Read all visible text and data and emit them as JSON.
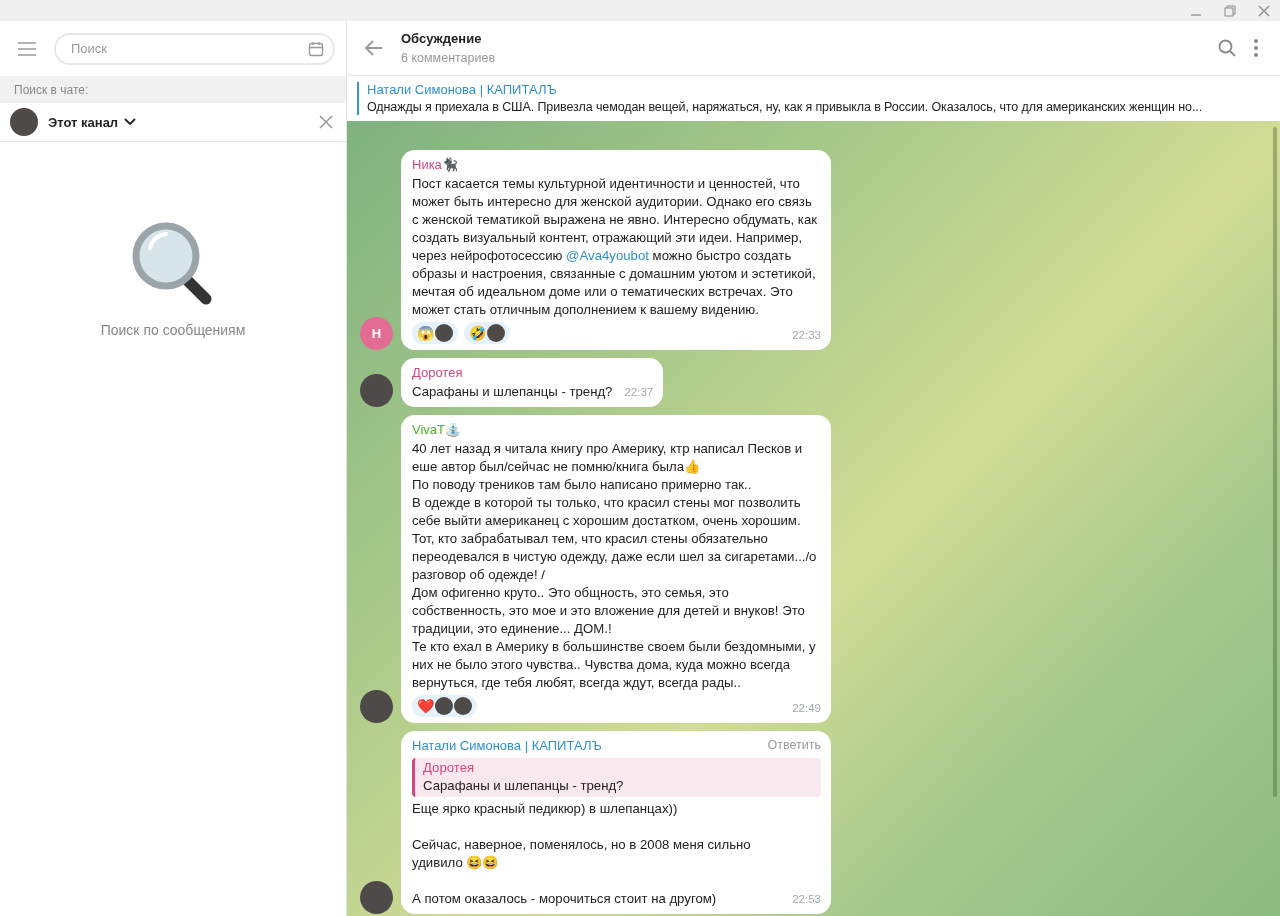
{
  "sidebar": {
    "search": {
      "placeholder": "Поиск"
    },
    "search_in_chat_label": "Поиск в чате:",
    "scope": {
      "label": "Этот канал"
    },
    "empty_state": {
      "text": "Поиск по сообщениям"
    }
  },
  "chat": {
    "title": "Обсуждение",
    "subtitle": "6 комментариев",
    "pinned": {
      "author": "Натали Симонова | КАПИТАЛЪ",
      "text": "Однажды я приехала в США. Привезла чемодан вещей, наряжаться, ну, как я привыкла в России. Оказалось, что для американских женщин но..."
    },
    "messages": [
      {
        "author": "Ника🐈‍⬛",
        "color": "#d6457f",
        "avatar": {
          "kind": "letter",
          "letter": "Н"
        },
        "text": [
          {
            "kind": "text",
            "text": "Пост касается темы культурной идентичности и ценностей, что может быть интересно для женской аудитории. Однако его связь с женской тематикой выражена не явно. Интересно обдумать, как создать визуальный контент, отражающий эти идеи. Например, через нейрофотосессию "
          },
          {
            "kind": "mention",
            "text": "@Ava4youbot"
          },
          {
            "kind": "text",
            "text": " можно быстро создать образы и настроения, связанные с домашним уютом и эстетикой, мечтая об идеальном доме или о тематических встречах. Это может стать отличным дополнением к вашему видению."
          }
        ],
        "reactions": [
          {
            "emoji": "😱",
            "avatars": [
              {
                "kind": "photo"
              }
            ]
          },
          {
            "emoji": "🤣",
            "avatars": [
              {
                "kind": "photo"
              }
            ]
          }
        ],
        "time": "22:33"
      },
      {
        "author": "Доротея",
        "color": "#d6457f",
        "avatar": {
          "kind": "photo"
        },
        "text": [
          {
            "kind": "text",
            "text": "Сарафаны и шлепанцы - тренд?"
          }
        ],
        "time": "22:37"
      },
      {
        "author": "VivaT⛲",
        "color": "#4fae2f",
        "avatar": {
          "kind": "photo"
        },
        "text": [
          {
            "kind": "text",
            "text": "40 лет назад я читала книгу про Америку, ктр написал Песков и еше автор был/сейчас не помню/книга была👍\nПо поводу треников там было написано примерно так..\nВ одежде в которой ты только, что красил стены мог позволить себе выйти американец с хорошим достатком, очень хорошим. Тот, кто забрабатывал тем, что красил стены обязательно переодевался в чистую одежду, даже если шел за сигаретами.../о разговор об одежде! /\nДом офигенно круто.. Это общность, это семья, это собственность, это мое и это вложение для детей и внуков! Это традиции, это единение... ДОМ.!\nТе кто ехал в Америку в большинстве своем были бездомными, у них не было этого чувства.. Чувства дома, куда можно всегда вернуться, где тебя любят, всегда ждут, всегда рады.."
          }
        ],
        "reactions": [
          {
            "emoji": "❤️",
            "avatars": [
              {
                "kind": "photo"
              },
              {
                "kind": "photo"
              }
            ]
          }
        ],
        "time": "22:49"
      },
      {
        "author": "Натали Симонова | КАПИТАЛЪ",
        "color": "#2f8fd0",
        "avatar": {
          "kind": "photo"
        },
        "reply_action": "Ответить",
        "quote": {
          "author": "Доротея",
          "text": "Сарафаны и шлепанцы - тренд?",
          "color": "#d6457f"
        },
        "text": [
          {
            "kind": "text",
            "text": "Еще ярко красный педикюр) в шлепанцах))\n\nСейчас, наверное, поменялось, но в 2008 меня сильно удивило 😆😆\n\nА потом оказалось - морочиться стоит на другом)"
          }
        ],
        "time": "22:53"
      }
    ]
  }
}
